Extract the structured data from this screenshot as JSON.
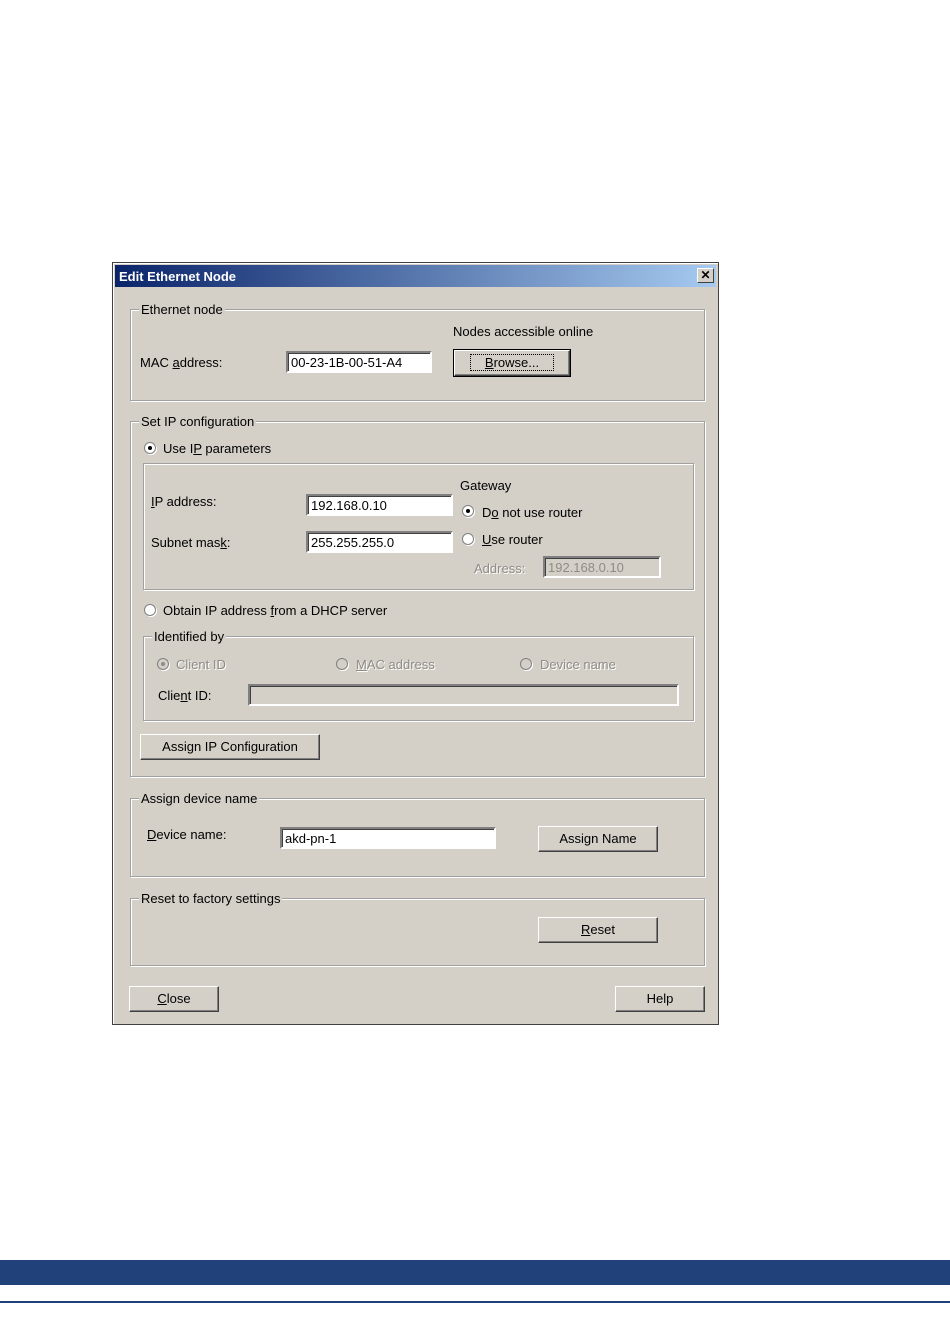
{
  "window": {
    "title": "Edit Ethernet Node",
    "close_glyph": "✕"
  },
  "ethernet_node": {
    "legend": "Ethernet node",
    "online_label": "Nodes accessible online",
    "mac_label_pre": "MAC ",
    "mac_label_u": "a",
    "mac_label_post": "ddress:",
    "mac_value": "00-23-1B-00-51-A4",
    "browse_u": "B",
    "browse_rest": "rowse..."
  },
  "ip_config": {
    "legend": "Set IP configuration",
    "use_ip_pre": "Use I",
    "use_ip_u": "P",
    "use_ip_post": " parameters",
    "ip_label_u": "I",
    "ip_label_rest": "P address:",
    "ip_value": "192.168.0.10",
    "subnet_pre": "Subnet mas",
    "subnet_u": "k",
    "subnet_post": ":",
    "subnet_value": "255.255.255.0",
    "gateway_label": "Gateway",
    "no_router_pre": "D",
    "no_router_u": "o",
    "no_router_post": " not use router",
    "use_router_u": "U",
    "use_router_rest": "se router",
    "address_label": "Address:",
    "address_value": "192.168.0.10",
    "dhcp_pre": "Obtain IP address ",
    "dhcp_u": "f",
    "dhcp_post": "rom a DHCP server",
    "identified_legend": "Identified by",
    "client_id_radio": "Client ID",
    "mac_radio_u": "M",
    "mac_radio_rest": "AC address",
    "device_radio": "Device name",
    "client_id_label_pre": "Clie",
    "client_id_label_u": "n",
    "client_id_label_post": "t ID:",
    "client_id_value": "",
    "assign_btn_pre": "Assi",
    "assign_btn_u": "g",
    "assign_btn_post": "n IP Configuration"
  },
  "device_name": {
    "legend": "Assign device name",
    "label_u": "D",
    "label_rest": "evice name:",
    "value": "akd-pn-1",
    "assign_btn": "Assign Name"
  },
  "reset": {
    "legend": "Reset to factory settings",
    "btn_u": "R",
    "btn_rest": "eset"
  },
  "footer_buttons": {
    "close_u": "C",
    "close_rest": "lose",
    "help": "Help"
  },
  "colors": {
    "dialog_bg": "#d4d0c8",
    "title_start": "#0a246a",
    "title_end": "#a6caf0",
    "footer_band": "#21417a"
  }
}
